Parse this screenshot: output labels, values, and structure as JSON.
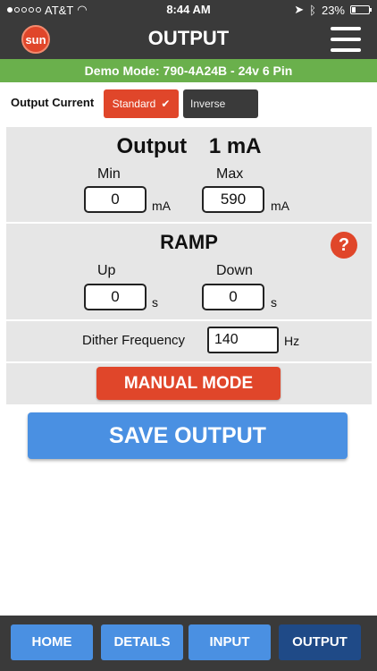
{
  "status_bar": {
    "carrier": "AT&T",
    "time": "8:44 AM",
    "battery": "23%"
  },
  "header": {
    "logo_text": "sun",
    "title": "OUTPUT"
  },
  "demo_banner": "Demo Mode: 790-4A24B - 24v 6 Pin",
  "output_current": {
    "label": "Output Current",
    "options": [
      "Standard",
      "Inverse"
    ],
    "selected": "Standard"
  },
  "output": {
    "title": "Output",
    "value": "1 mA",
    "min_label": "Min",
    "min_value": "0",
    "min_unit": "mA",
    "max_label": "Max",
    "max_value": "590",
    "max_unit": "mA"
  },
  "ramp": {
    "title": "RAMP",
    "help_icon": "?",
    "up_label": "Up",
    "up_value": "0",
    "up_unit": "s",
    "down_label": "Down",
    "down_value": "0",
    "down_unit": "s"
  },
  "dither": {
    "label": "Dither Frequency",
    "value": "140",
    "unit": "Hz"
  },
  "manual_mode_label": "MANUAL MODE",
  "save_label": "SAVE OUTPUT",
  "nav": {
    "home": "HOME",
    "details": "DETAILS",
    "input": "INPUT",
    "output": "OUTPUT",
    "active": "OUTPUT"
  },
  "colors": {
    "accent_red": "#e0462a",
    "accent_blue": "#4a90e2",
    "active_blue": "#1f4a87",
    "banner_green": "#6ab04c",
    "dark_bar": "#3a3a3a"
  }
}
